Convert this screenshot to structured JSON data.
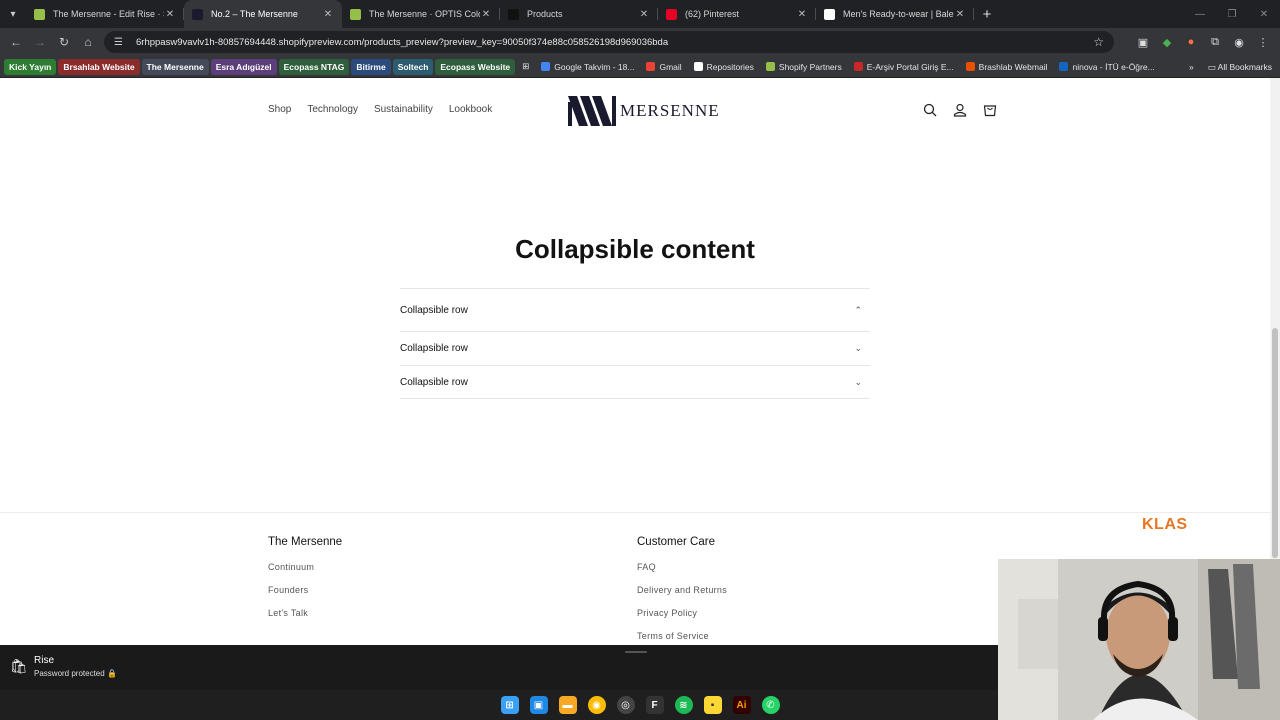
{
  "browser": {
    "tabs": [
      {
        "title": "The Mersenne - Edit Rise · Shop",
        "favicon_color": "#95bf47",
        "active": false
      },
      {
        "title": "No.2 – The Mersenne",
        "favicon_color": "#1a1a2e",
        "active": true
      },
      {
        "title": "The Mersenne · OPTIS Color Sw",
        "favicon_color": "#95bf47",
        "active": false
      },
      {
        "title": "Products",
        "favicon_color": "#111111",
        "active": false
      },
      {
        "title": "(62) Pinterest",
        "favicon_color": "#e60023",
        "active": false
      },
      {
        "title": "Men's Ready-to-wear | Balencia",
        "favicon_color": "#ffffff",
        "active": false
      }
    ],
    "url": "6rhppasw9vavlv1h-80857694448.shopifypreview.com/products_preview?preview_key=90050f374e88c058526198d969036bda",
    "bookmarks": [
      {
        "label": "Kick Yayın",
        "style": "pill",
        "color": "#2e7d32"
      },
      {
        "label": "Brsahlab Website",
        "style": "pill",
        "color": "#8b2c2c"
      },
      {
        "label": "The Mersenne",
        "style": "pill",
        "color": "#444a58"
      },
      {
        "label": "Esra Adıgüzel",
        "style": "pill",
        "color": "#5b3e7a"
      },
      {
        "label": "Ecopass NTAG",
        "style": "pill",
        "color": "#2f5e3d"
      },
      {
        "label": "Bitirme",
        "style": "pill",
        "color": "#2a4b7c"
      },
      {
        "label": "Soltech",
        "style": "pill",
        "color": "#2c5c70"
      },
      {
        "label": "Ecopass Website",
        "style": "pill",
        "color": "#2f5e3d"
      },
      {
        "label": "Google Takvim - 18...",
        "style": "icon",
        "color": "#4285f4"
      },
      {
        "label": "Gmail",
        "style": "icon",
        "color": "#ea4335"
      },
      {
        "label": "Repositories",
        "style": "icon",
        "color": "#ffffff"
      },
      {
        "label": "Shopify Partners",
        "style": "icon",
        "color": "#95bf47"
      },
      {
        "label": "E-Arşiv Portal Giriş E...",
        "style": "icon",
        "color": "#c62828"
      },
      {
        "label": "Brashlab Webmail",
        "style": "icon",
        "color": "#e65100"
      },
      {
        "label": "ninova - İTÜ e-Öğre...",
        "style": "icon",
        "color": "#1565c0"
      }
    ],
    "all_bookmarks_label": "All Bookmarks"
  },
  "header": {
    "nav": [
      "Shop",
      "Technology",
      "Sustainability",
      "Lookbook"
    ],
    "logo_text": "MERSENNE"
  },
  "main": {
    "title": "Collapsible content",
    "rows": [
      {
        "label": "Collapsible row",
        "expanded": true
      },
      {
        "label": "Collapsible row",
        "expanded": false
      },
      {
        "label": "Collapsible row",
        "expanded": false
      }
    ]
  },
  "footer": {
    "col1": {
      "title": "The Mersenne",
      "links": [
        "Continuum",
        "Founders",
        "Let's Talk"
      ]
    },
    "col2": {
      "title": "Customer Care",
      "links": [
        "FAQ",
        "Delivery and Returns",
        "Privacy Policy",
        "Terms of Service"
      ]
    },
    "klas": "KLAS"
  },
  "shop_bar": {
    "store_name": "Rise",
    "status": "Password protected"
  },
  "icons": {
    "chevron_up": "⌃",
    "chevron_down": "⌄"
  }
}
